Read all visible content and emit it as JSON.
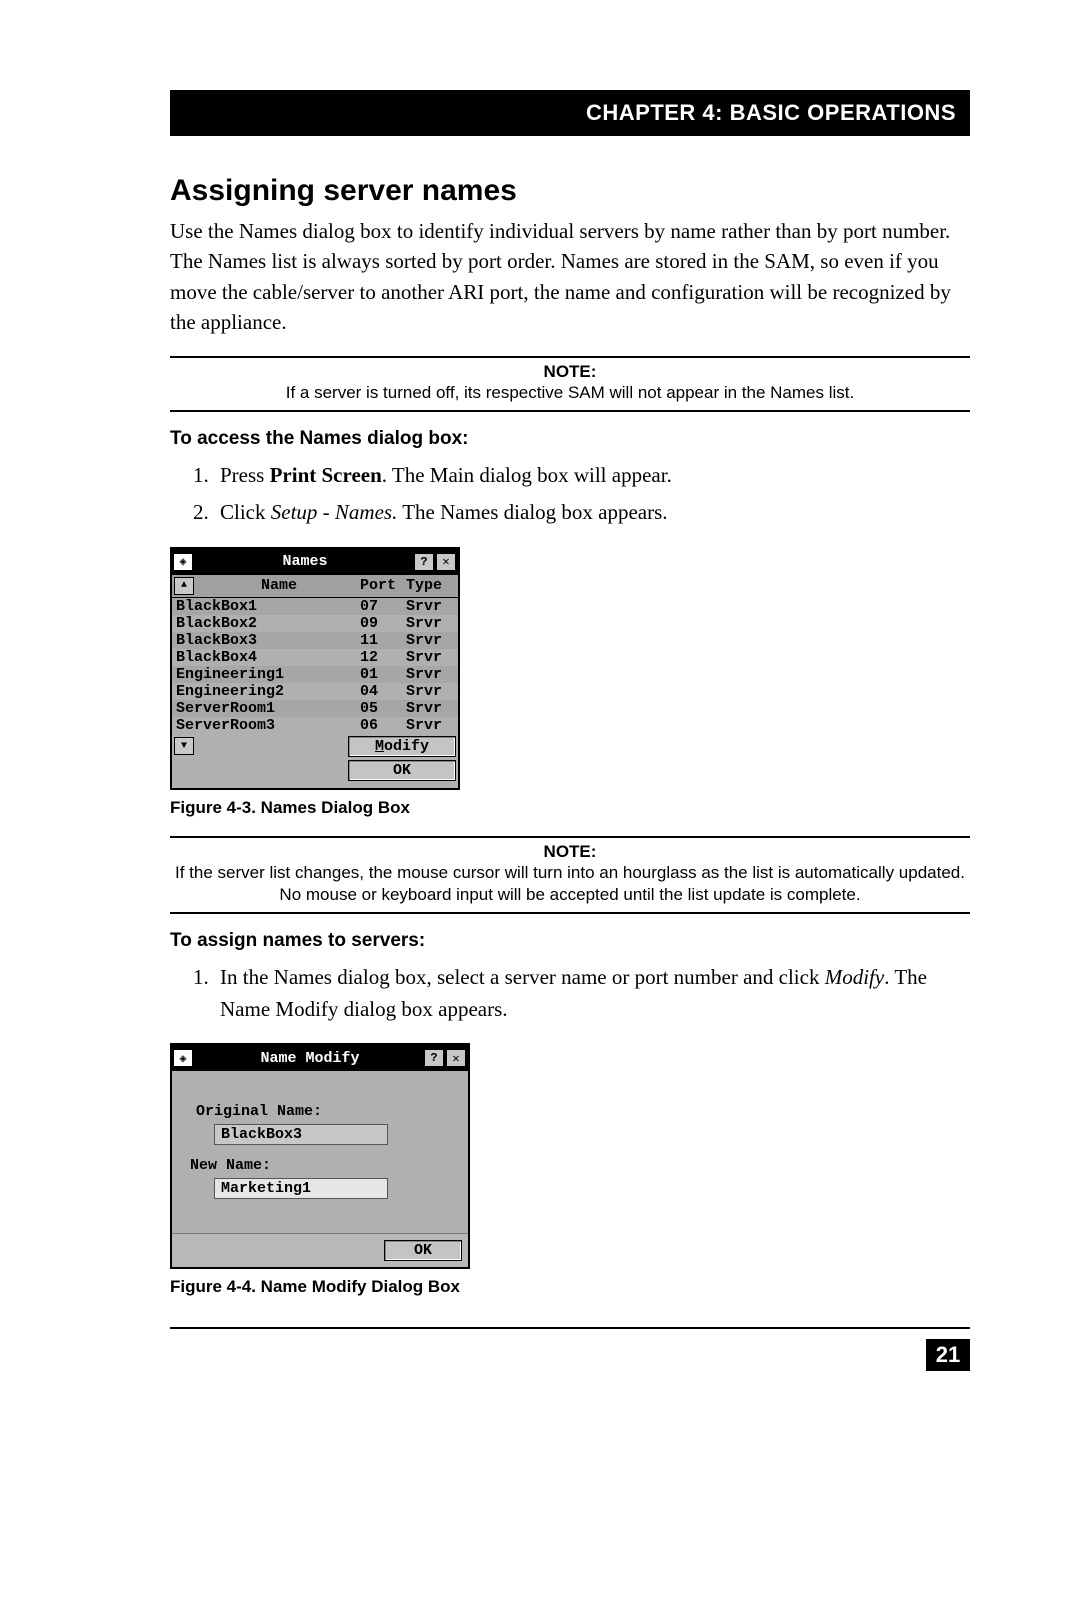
{
  "chapter_header": "CHAPTER 4: BASIC OPERATIONS",
  "section_title": "Assigning server names",
  "intro_paragraph": "Use the Names dialog box to identify individual servers by name rather than by port number. The Names list is always sorted by port order. Names are stored in the SAM, so even if you move the cable/server to another ARI port, the name and configuration will be recognized by the appliance.",
  "note1": {
    "label": "NOTE:",
    "text": "If a server is turned off, its respective SAM will not appear in the Names list."
  },
  "subhead1": "To access the Names dialog box:",
  "step1_prefix": "Press ",
  "step1_bold": "Print Screen",
  "step1_suffix": ". The Main dialog box will appear.",
  "step2_prefix": "Click ",
  "step2_italic": "Setup - Names.",
  "step2_suffix": " The Names dialog box appears.",
  "names_dialog": {
    "title": "Names",
    "col_name": "Name",
    "col_port": "Port",
    "col_type": "Type",
    "rows": [
      {
        "name": "BlackBox1",
        "port": "07",
        "type": "Srvr"
      },
      {
        "name": "BlackBox2",
        "port": "09",
        "type": "Srvr"
      },
      {
        "name": "BlackBox3",
        "port": "11",
        "type": "Srvr"
      },
      {
        "name": "BlackBox4",
        "port": "12",
        "type": "Srvr"
      },
      {
        "name": "Engineering1",
        "port": "01",
        "type": "Srvr"
      },
      {
        "name": "Engineering2",
        "port": "04",
        "type": "Srvr"
      },
      {
        "name": "ServerRoom1",
        "port": "05",
        "type": "Srvr"
      },
      {
        "name": "ServerRoom3",
        "port": "06",
        "type": "Srvr"
      }
    ],
    "modify_btn": "Modify",
    "ok_btn": "OK"
  },
  "figure1_caption": "Figure 4-3. Names Dialog Box",
  "note2": {
    "label": "NOTE:",
    "text": "If the server list changes, the mouse cursor will turn into an hourglass as the list is automatically updated. No mouse or keyboard input will be accepted until the list update is complete."
  },
  "subhead2": "To assign names to servers:",
  "assign_step_prefix": "In the Names dialog box, select a server name or port number and click ",
  "assign_step_italic": "Modify",
  "assign_step_suffix": ". The Name Modify dialog box appears.",
  "modify_dialog": {
    "title": "Name Modify",
    "orig_label": "Original Name:",
    "orig_value": "BlackBox3",
    "new_label": "New Name:",
    "new_value": "Marketing1",
    "ok_btn": "OK"
  },
  "figure2_caption": "Figure 4-4. Name Modify Dialog Box",
  "page_number": "21"
}
